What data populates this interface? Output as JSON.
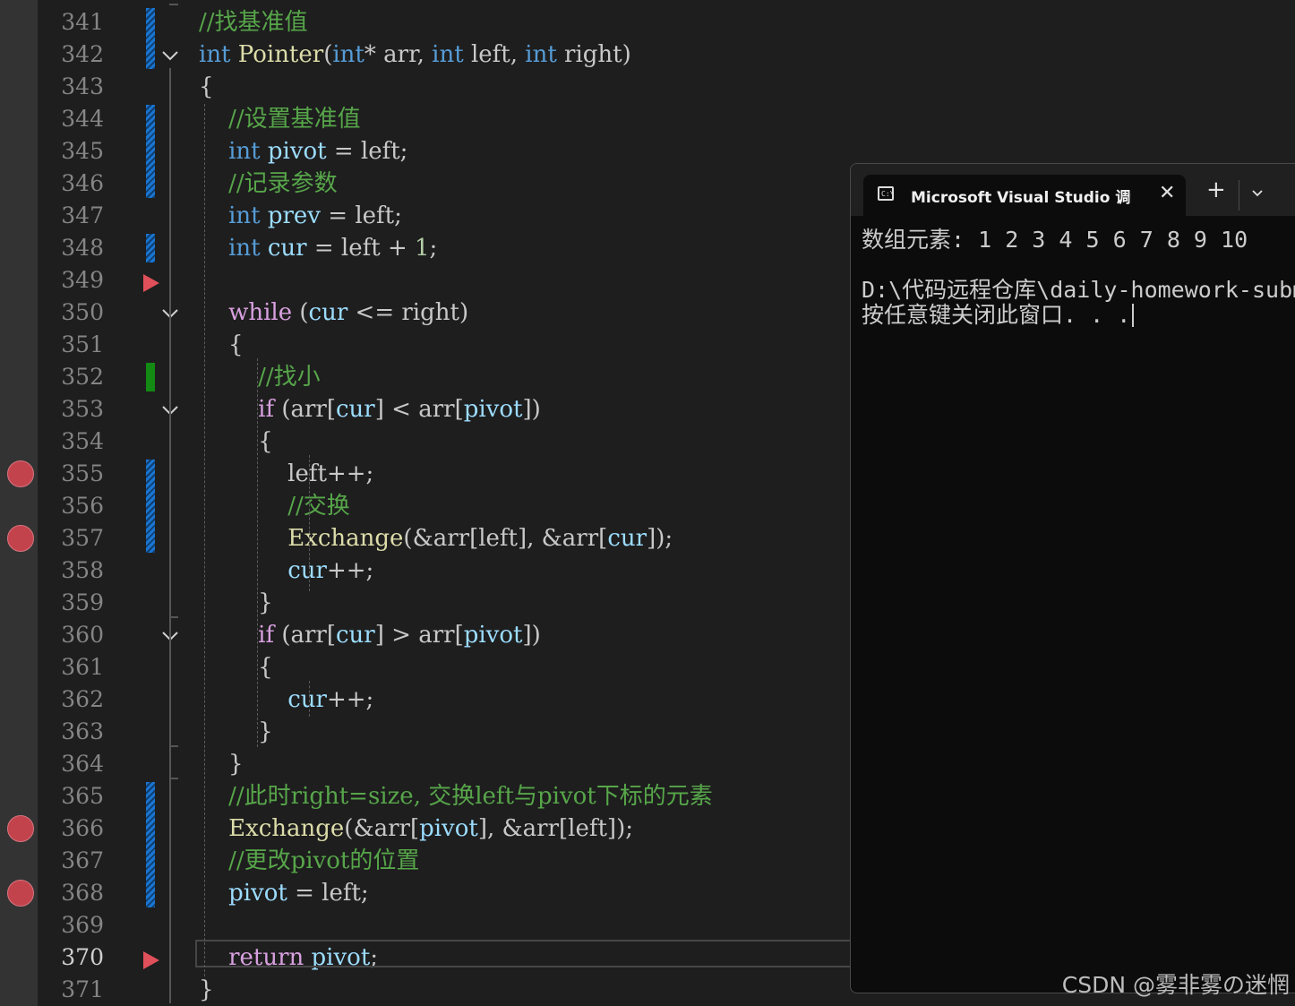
{
  "editor": {
    "current_line": 370,
    "line_numbers": [
      "341",
      "342",
      "343",
      "344",
      "345",
      "346",
      "347",
      "348",
      "349",
      "350",
      "351",
      "352",
      "353",
      "354",
      "355",
      "356",
      "357",
      "358",
      "359",
      "360",
      "361",
      "362",
      "363",
      "364",
      "365",
      "366",
      "367",
      "368",
      "369",
      "370",
      "371"
    ],
    "breakpoints": [
      "355",
      "357",
      "366",
      "368"
    ],
    "code": [
      {
        "line": "341",
        "tokens": [
          {
            "t": "//找基准值",
            "c": "cm"
          }
        ]
      },
      {
        "line": "342",
        "tokens": [
          {
            "t": "int",
            "c": "kw"
          },
          {
            "t": " ",
            "c": "pl"
          },
          {
            "t": "Pointer",
            "c": "fn"
          },
          {
            "t": "(",
            "c": "pl"
          },
          {
            "t": "int",
            "c": "kw"
          },
          {
            "t": "* arr, ",
            "c": "pl"
          },
          {
            "t": "int",
            "c": "kw"
          },
          {
            "t": " left, ",
            "c": "pl"
          },
          {
            "t": "int",
            "c": "kw"
          },
          {
            "t": " right)",
            "c": "pl"
          }
        ]
      },
      {
        "line": "343",
        "tokens": [
          {
            "t": "{",
            "c": "pl"
          }
        ]
      },
      {
        "line": "344",
        "tokens": [
          {
            "t": "    ",
            "c": "pl"
          },
          {
            "t": "//设置基准值",
            "c": "cm"
          }
        ]
      },
      {
        "line": "345",
        "tokens": [
          {
            "t": "    ",
            "c": "pl"
          },
          {
            "t": "int",
            "c": "kw"
          },
          {
            "t": " ",
            "c": "pl"
          },
          {
            "t": "pivot",
            "c": "var"
          },
          {
            "t": " = left;",
            "c": "pl"
          }
        ]
      },
      {
        "line": "346",
        "tokens": [
          {
            "t": "    ",
            "c": "pl"
          },
          {
            "t": "//记录参数",
            "c": "cm"
          }
        ]
      },
      {
        "line": "347",
        "tokens": [
          {
            "t": "    ",
            "c": "pl"
          },
          {
            "t": "int",
            "c": "kw"
          },
          {
            "t": " ",
            "c": "pl"
          },
          {
            "t": "prev",
            "c": "var"
          },
          {
            "t": " = left;",
            "c": "pl"
          }
        ]
      },
      {
        "line": "348",
        "tokens": [
          {
            "t": "    ",
            "c": "pl"
          },
          {
            "t": "int",
            "c": "kw"
          },
          {
            "t": " ",
            "c": "pl"
          },
          {
            "t": "cur",
            "c": "var"
          },
          {
            "t": " = left + ",
            "c": "pl"
          },
          {
            "t": "1",
            "c": "num"
          },
          {
            "t": ";",
            "c": "pl"
          }
        ]
      },
      {
        "line": "349",
        "tokens": []
      },
      {
        "line": "350",
        "tokens": [
          {
            "t": "    ",
            "c": "pl"
          },
          {
            "t": "while",
            "c": "ctl"
          },
          {
            "t": " (",
            "c": "pl"
          },
          {
            "t": "cur",
            "c": "var"
          },
          {
            "t": " <= right)",
            "c": "pl"
          }
        ]
      },
      {
        "line": "351",
        "tokens": [
          {
            "t": "    {",
            "c": "pl"
          }
        ]
      },
      {
        "line": "352",
        "tokens": [
          {
            "t": "        ",
            "c": "pl"
          },
          {
            "t": "//找小",
            "c": "cm"
          }
        ]
      },
      {
        "line": "353",
        "tokens": [
          {
            "t": "        ",
            "c": "pl"
          },
          {
            "t": "if",
            "c": "ctl"
          },
          {
            "t": " (arr[",
            "c": "pl"
          },
          {
            "t": "cur",
            "c": "var"
          },
          {
            "t": "] < arr[",
            "c": "pl"
          },
          {
            "t": "pivot",
            "c": "var"
          },
          {
            "t": "])",
            "c": "pl"
          }
        ]
      },
      {
        "line": "354",
        "tokens": [
          {
            "t": "        {",
            "c": "pl"
          }
        ]
      },
      {
        "line": "355",
        "tokens": [
          {
            "t": "            left++;",
            "c": "pl"
          }
        ]
      },
      {
        "line": "356",
        "tokens": [
          {
            "t": "            ",
            "c": "pl"
          },
          {
            "t": "//交换",
            "c": "cm"
          }
        ]
      },
      {
        "line": "357",
        "tokens": [
          {
            "t": "            ",
            "c": "pl"
          },
          {
            "t": "Exchange",
            "c": "fn"
          },
          {
            "t": "(&arr[left], &arr[",
            "c": "pl"
          },
          {
            "t": "cur",
            "c": "var"
          },
          {
            "t": "]);",
            "c": "pl"
          }
        ]
      },
      {
        "line": "358",
        "tokens": [
          {
            "t": "            ",
            "c": "pl"
          },
          {
            "t": "cur",
            "c": "var"
          },
          {
            "t": "++;",
            "c": "pl"
          }
        ]
      },
      {
        "line": "359",
        "tokens": [
          {
            "t": "        }",
            "c": "pl"
          }
        ]
      },
      {
        "line": "360",
        "tokens": [
          {
            "t": "        ",
            "c": "pl"
          },
          {
            "t": "if",
            "c": "ctl"
          },
          {
            "t": " (arr[",
            "c": "pl"
          },
          {
            "t": "cur",
            "c": "var"
          },
          {
            "t": "] > arr[",
            "c": "pl"
          },
          {
            "t": "pivot",
            "c": "var"
          },
          {
            "t": "])",
            "c": "pl"
          }
        ]
      },
      {
        "line": "361",
        "tokens": [
          {
            "t": "        {",
            "c": "pl"
          }
        ]
      },
      {
        "line": "362",
        "tokens": [
          {
            "t": "            ",
            "c": "pl"
          },
          {
            "t": "cur",
            "c": "var"
          },
          {
            "t": "++;",
            "c": "pl"
          }
        ]
      },
      {
        "line": "363",
        "tokens": [
          {
            "t": "        }",
            "c": "pl"
          }
        ]
      },
      {
        "line": "364",
        "tokens": [
          {
            "t": "    }",
            "c": "pl"
          }
        ]
      },
      {
        "line": "365",
        "tokens": [
          {
            "t": "    ",
            "c": "pl"
          },
          {
            "t": "//此时right=size, 交换left与pivot下标的元素",
            "c": "cm"
          }
        ]
      },
      {
        "line": "366",
        "tokens": [
          {
            "t": "    ",
            "c": "pl"
          },
          {
            "t": "Exchange",
            "c": "fn"
          },
          {
            "t": "(&arr[",
            "c": "pl"
          },
          {
            "t": "pivot",
            "c": "var"
          },
          {
            "t": "], &arr[left]);",
            "c": "pl"
          }
        ]
      },
      {
        "line": "367",
        "tokens": [
          {
            "t": "    ",
            "c": "pl"
          },
          {
            "t": "//更改pivot的位置",
            "c": "cm"
          }
        ]
      },
      {
        "line": "368",
        "tokens": [
          {
            "t": "    ",
            "c": "pl"
          },
          {
            "t": "pivot",
            "c": "var"
          },
          {
            "t": " = left;",
            "c": "pl"
          }
        ]
      },
      {
        "line": "369",
        "tokens": []
      },
      {
        "line": "370",
        "tokens": [
          {
            "t": "    ",
            "c": "pl"
          },
          {
            "t": "return",
            "c": "ctl"
          },
          {
            "t": " ",
            "c": "pl"
          },
          {
            "t": "pivot",
            "c": "var"
          },
          {
            "t": ";",
            "c": "pl"
          }
        ]
      },
      {
        "line": "371",
        "tokens": [
          {
            "t": "}",
            "c": "pl"
          }
        ]
      }
    ]
  },
  "console": {
    "tab_title": "Microsoft Visual Studio 调试控制台",
    "tab_icon": "console-icon",
    "close_icon": "close-icon",
    "new_tab_label": "+",
    "dropdown_icon": "chevron-down-icon",
    "lines": [
      "数组元素: 1 2 3 4 5 6 7 8 9 10",
      "",
      "D:\\代码远程仓库\\daily-homework-submission",
      "按任意键关闭此窗口. . ."
    ]
  },
  "watermark": "CSDN @雾非雾の迷惘",
  "colors": {
    "keyword": "#569cd6",
    "control": "#d8a0df",
    "function": "#dcdcaa",
    "variable": "#9cdcfe",
    "comment": "#57a64a",
    "breakpoint": "#c3434d",
    "change_bar": "#1a75d1",
    "saved_bar": "#138a13"
  }
}
